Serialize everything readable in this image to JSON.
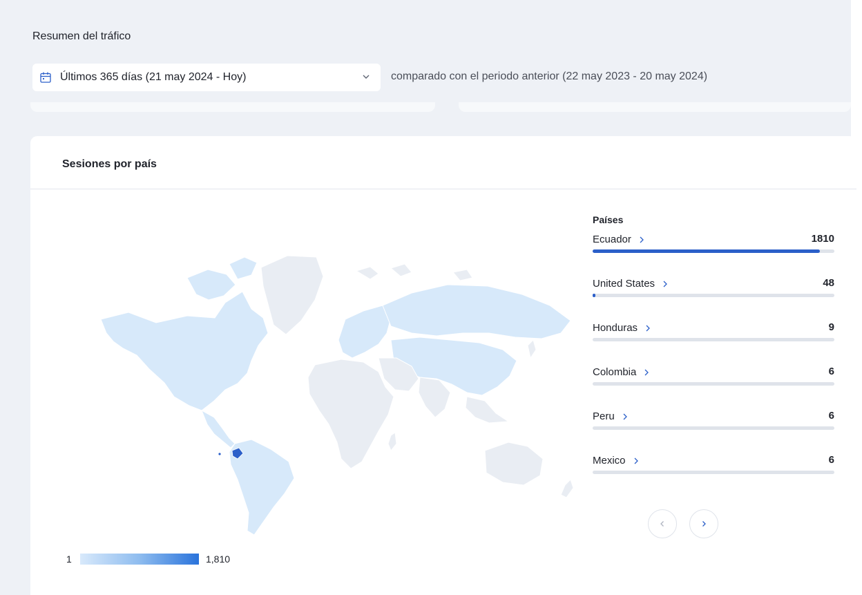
{
  "header": {
    "title": "Resumen del tráfico",
    "date_range_label": "Últimos 365 días (21 may 2024 - Hoy)",
    "comparison_text": "comparado con el periodo anterior (22 may 2023 - 20 may 2024)"
  },
  "card": {
    "title": "Sesiones por país"
  },
  "legend": {
    "min": "1",
    "max": "1,810"
  },
  "countries": {
    "header": "Países",
    "items": [
      {
        "name": "Ecuador",
        "value": "1810",
        "fraction": 0.94
      },
      {
        "name": "United States",
        "value": "48",
        "fraction": 0.012
      },
      {
        "name": "Honduras",
        "value": "9",
        "fraction": 0.0
      },
      {
        "name": "Colombia",
        "value": "6",
        "fraction": 0.0
      },
      {
        "name": "Peru",
        "value": "6",
        "fraction": 0.0
      },
      {
        "name": "Mexico",
        "value": "6",
        "fraction": 0.0
      }
    ]
  },
  "icons": {
    "date": "calendar-icon",
    "dropdown": "chevron-down-icon",
    "country_link": "chevron-right-icon",
    "prev": "chevron-left-icon",
    "next": "chevron-right-icon"
  },
  "colors": {
    "accent": "#2b5fc9",
    "map_highlight": "#2b5fc9",
    "map_light": "#d7e9fa",
    "map_none": "#e9edf3"
  }
}
